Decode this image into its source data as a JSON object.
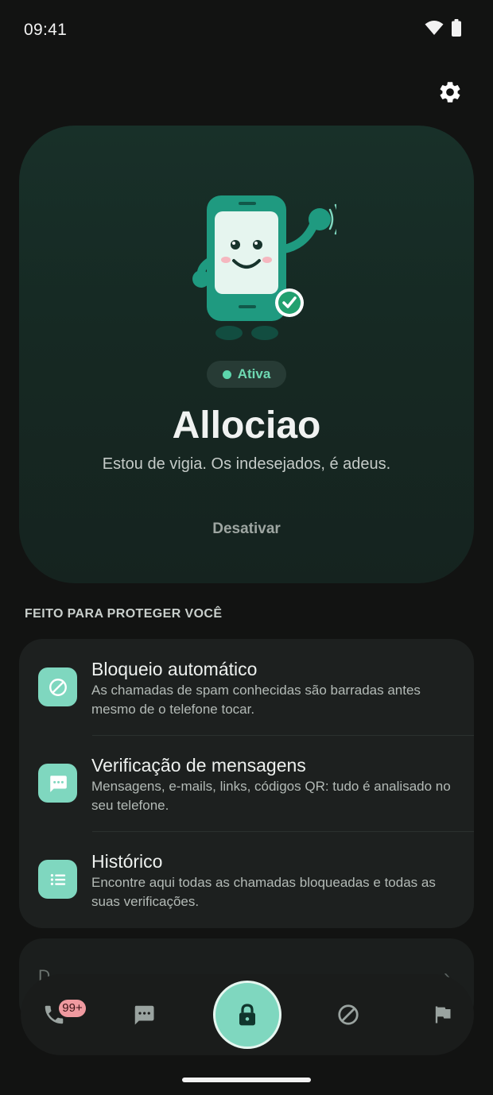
{
  "status_bar": {
    "time": "09:41",
    "icons": [
      "wifi-icon",
      "battery-icon"
    ]
  },
  "settings": {
    "icon": "gear-icon"
  },
  "hero": {
    "status_label": "Ativa",
    "title": "Allociao",
    "subtitle": "Estou de vigia. Os indesejados, é adeus.",
    "deactivate_label": "Desativar"
  },
  "section_title": "FEITO PARA PROTEGER VOCÊ",
  "features": [
    {
      "icon": "block-icon",
      "title": "Bloqueio automático",
      "description": "As chamadas de spam conhecidas são barradas antes mesmo de o telefone tocar."
    },
    {
      "icon": "message-icon",
      "title": "Verificação de mensagens",
      "description": "Mensagens, e-mails, links, códigos QR: tudo é analisado no seu telefone."
    },
    {
      "icon": "list-icon",
      "title": "Histórico",
      "description": "Encontre aqui todas as chamadas bloqueadas e todas as suas verificações."
    }
  ],
  "peek_card": {
    "text": "D",
    "chevron": "›"
  },
  "bottom_nav": {
    "items": [
      "phone-icon",
      "chat-icon",
      "lock-icon",
      "block-icon",
      "flag-icon"
    ],
    "badge": "99+"
  },
  "colors": {
    "background": "#121312",
    "accent": "#7fd7bf",
    "badge": "#ef9aa0"
  }
}
